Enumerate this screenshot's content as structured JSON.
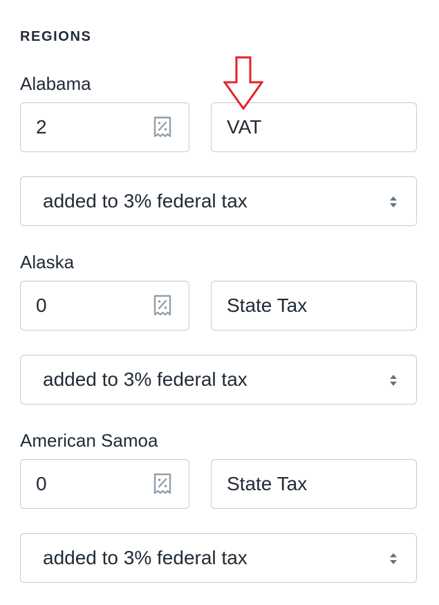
{
  "section": {
    "title": "REGIONS"
  },
  "regions": [
    {
      "name": "Alabama",
      "rate": "2",
      "tax_name": "VAT",
      "mode": "added to 3% federal tax"
    },
    {
      "name": "Alaska",
      "rate": "0",
      "tax_name": "State Tax",
      "mode": "added to 3% federal tax"
    },
    {
      "name": "American Samoa",
      "rate": "0",
      "tax_name": "State Tax",
      "mode": "added to 3% federal tax"
    }
  ],
  "icons": {
    "rate": "receipt-percent-icon",
    "select": "select-updown-icon",
    "annotation": "down-arrow-icon"
  },
  "colors": {
    "text": "#212b36",
    "border": "#c4cdd5",
    "icon": "#919eab",
    "annotation": "#e5222a"
  }
}
